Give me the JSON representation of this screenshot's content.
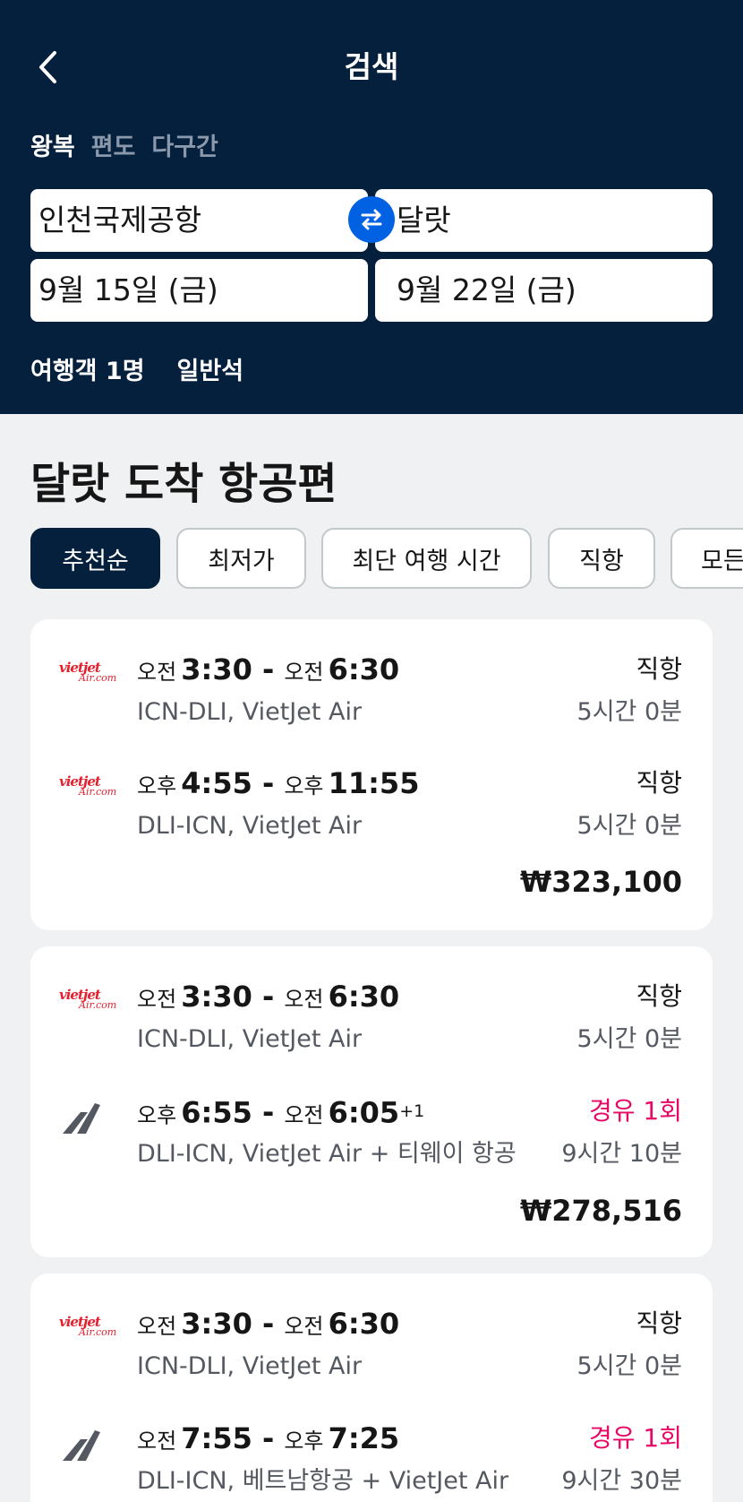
{
  "header": {
    "title": "검색",
    "trip_types": [
      "왕복",
      "편도",
      "다구간"
    ],
    "origin": "인천국제공항",
    "destination": "달랏",
    "depart_date": "9월 15일 (금)",
    "return_date": "9월 22일 (금)",
    "travelers": "여행객 1명",
    "cabin": "일반석"
  },
  "results": {
    "title": "달랏 도착 항공편",
    "sort_chips": [
      "추천순",
      "최저가",
      "최단 여행 시간",
      "직항",
      "모든"
    ]
  },
  "airline_logo_text": {
    "top": "vietjet",
    "bottom": "Air.com"
  },
  "colors": {
    "header_bg": "#05203c",
    "accent": "#0062e3",
    "stop_red": "#e70866"
  },
  "cards": [
    {
      "legs": [
        {
          "dep_ampm": "오전",
          "dep_time": "3:30",
          "arr_ampm": "오전",
          "arr_time": "6:30",
          "arr_day": "",
          "route": "ICN-DLI, VietJet Air",
          "stops": "직항",
          "duration": "5시간 0분",
          "logo": "vietjet-logo"
        },
        {
          "dep_ampm": "오후",
          "dep_time": "4:55",
          "arr_ampm": "오후",
          "arr_time": "11:55",
          "arr_day": "",
          "route": "DLI-ICN, VietJet Air",
          "stops": "직항",
          "duration": "5시간 0분",
          "logo": "vietjet-logo"
        }
      ],
      "price": "₩323,100"
    },
    {
      "legs": [
        {
          "dep_ampm": "오전",
          "dep_time": "3:30",
          "arr_ampm": "오전",
          "arr_time": "6:30",
          "arr_day": "",
          "route": "ICN-DLI, VietJet Air",
          "stops": "직항",
          "duration": "5시간 0분",
          "logo": "vietjet-logo"
        },
        {
          "dep_ampm": "오후",
          "dep_time": "6:55",
          "arr_ampm": "오전",
          "arr_time": "6:05",
          "arr_day": "+1",
          "route": "DLI-ICN, VietJet Air + 티웨이 항공",
          "stops": "경유 1회",
          "duration": "9시간 10분",
          "logo": "multi-airline-icon"
        }
      ],
      "price": "₩278,516"
    },
    {
      "legs": [
        {
          "dep_ampm": "오전",
          "dep_time": "3:30",
          "arr_ampm": "오전",
          "arr_time": "6:30",
          "arr_day": "",
          "route": "ICN-DLI, VietJet Air",
          "stops": "직항",
          "duration": "5시간 0분",
          "logo": "vietjet-logo"
        },
        {
          "dep_ampm": "오전",
          "dep_time": "7:55",
          "arr_ampm": "오후",
          "arr_time": "7:25",
          "arr_day": "",
          "route": "DLI-ICN, 베트남항공 + VietJet Air",
          "stops": "경유 1회",
          "duration": "9시간 30분",
          "logo": "multi-airline-icon"
        }
      ],
      "price": ""
    }
  ]
}
